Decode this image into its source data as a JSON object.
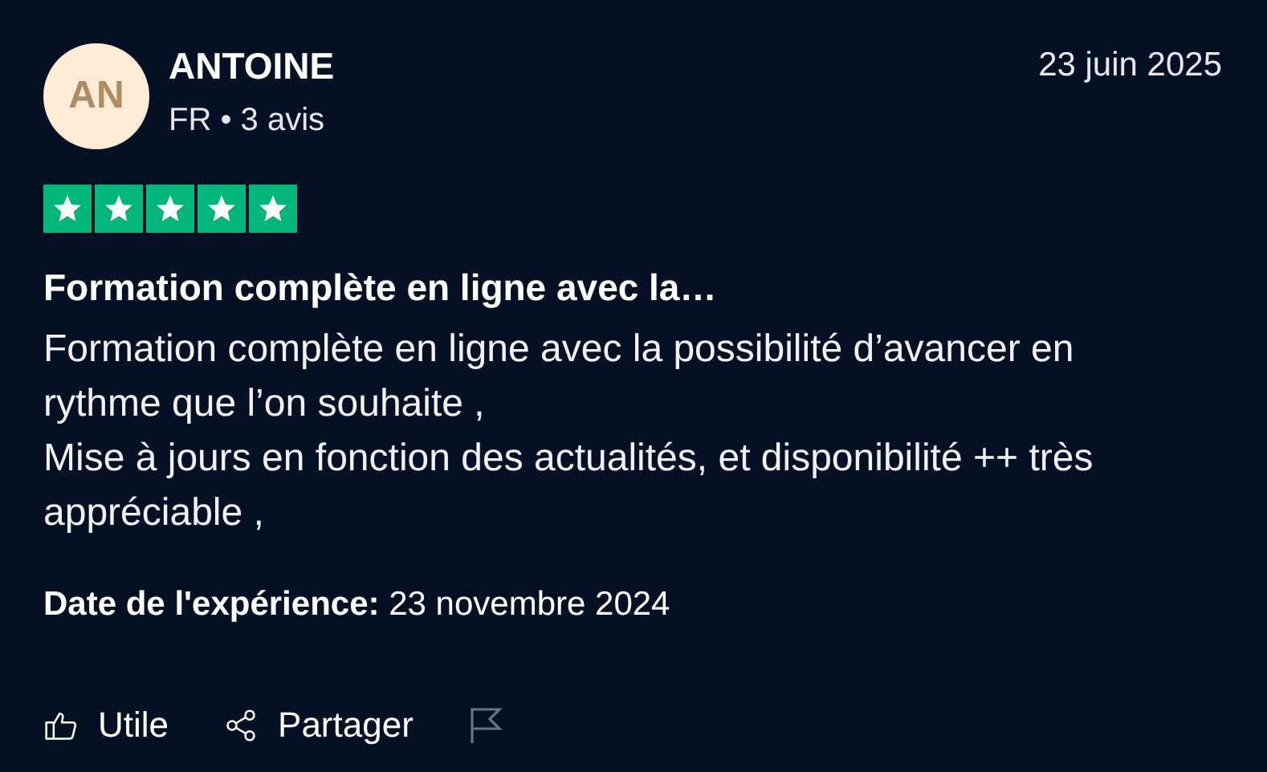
{
  "reviewer": {
    "initials": "AN",
    "name": "ANTOINE",
    "meta": "FR • 3 avis"
  },
  "date": "23 juin 2025",
  "rating": {
    "stars": 5
  },
  "title": "Formation complète en ligne avec la…",
  "body": [
    "Formation complète en ligne avec la possibilité d’avancer en rythme que l’on souhaite ,",
    "Mise à jours en fonction des actualités, et disponibilité ++ très appréciable ,"
  ],
  "experience": {
    "label": "Date de l'expérience:",
    "value": "23 novembre 2024"
  },
  "actions": [
    {
      "kind": "like",
      "label": "Utile"
    },
    {
      "kind": "share",
      "label": "Partager"
    },
    {
      "kind": "flag"
    }
  ]
}
